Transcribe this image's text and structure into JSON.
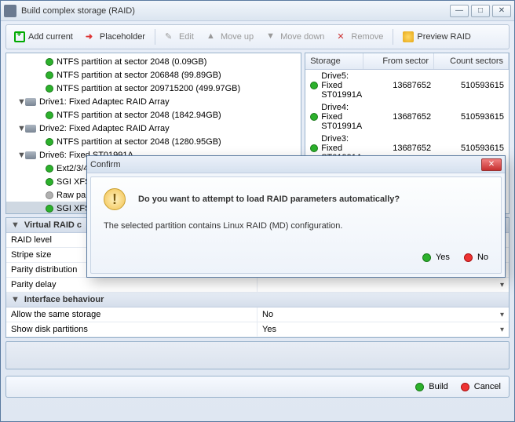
{
  "window": {
    "title": "Build complex storage (RAID)"
  },
  "toolbar": {
    "add": "Add current",
    "placeholder": "Placeholder",
    "edit": "Edit",
    "moveup": "Move up",
    "movedown": "Move down",
    "remove": "Remove",
    "preview": "Preview RAID"
  },
  "tree": {
    "items": [
      {
        "indent": 2,
        "dot": "green",
        "label": "NTFS partition at sector 2048 (0.09GB)"
      },
      {
        "indent": 2,
        "dot": "green",
        "label": "NTFS partition at sector 206848 (99.89GB)"
      },
      {
        "indent": 2,
        "dot": "green",
        "label": "NTFS partition at sector 209715200 (499.97GB)"
      },
      {
        "indent": 0,
        "exp": "▼",
        "hdd": true,
        "label": "Drive1: Fixed Adaptec RAID Array"
      },
      {
        "indent": 2,
        "dot": "green",
        "label": "NTFS partition at sector 2048 (1842.94GB)"
      },
      {
        "indent": 0,
        "exp": "▼",
        "hdd": true,
        "label": "Drive2: Fixed Adaptec RAID Array"
      },
      {
        "indent": 2,
        "dot": "green",
        "label": "NTFS partition at sector 2048 (1280.95GB)"
      },
      {
        "indent": 0,
        "exp": "▼",
        "hdd": true,
        "label": "Drive6: Fixed ST01991A"
      },
      {
        "indent": 2,
        "dot": "green",
        "label": "Ext2/3/4"
      },
      {
        "indent": 2,
        "dot": "green",
        "label": "SGI XFS"
      },
      {
        "indent": 2,
        "dot": "grey",
        "label": "Raw par"
      },
      {
        "indent": 2,
        "dot": "green",
        "label": "SGI XFS",
        "selected": true
      }
    ]
  },
  "grid": {
    "headers": {
      "storage": "Storage",
      "from": "From sector",
      "count": "Count sectors"
    },
    "rows": [
      {
        "name": "Drive5: Fixed ST01991A",
        "from": "13687652",
        "count": "510593615"
      },
      {
        "name": "Drive4: Fixed ST01991A",
        "from": "13687652",
        "count": "510593615"
      },
      {
        "name": "Drive3: Fixed ST01991A",
        "from": "13687652",
        "count": "510593615"
      }
    ]
  },
  "props": {
    "g1": {
      "title": "Virtual RAID c",
      "rows": [
        {
          "k": "RAID level",
          "v": ""
        },
        {
          "k": "Stripe size",
          "v": ""
        },
        {
          "k": "Parity distribution",
          "v": ""
        },
        {
          "k": "Parity delay",
          "v": ""
        }
      ]
    },
    "g2": {
      "title": "Interface behaviour",
      "rows": [
        {
          "k": "Allow the same storage",
          "v": "No"
        },
        {
          "k": "Show disk partitions",
          "v": "Yes"
        }
      ]
    }
  },
  "footer": {
    "build": "Build",
    "cancel": "Cancel"
  },
  "modal": {
    "title": "Confirm",
    "question": "Do you want to attempt to load RAID parameters automatically?",
    "sub": "The selected partition contains Linux RAID (MD) configuration.",
    "yes": "Yes",
    "no": "No"
  }
}
